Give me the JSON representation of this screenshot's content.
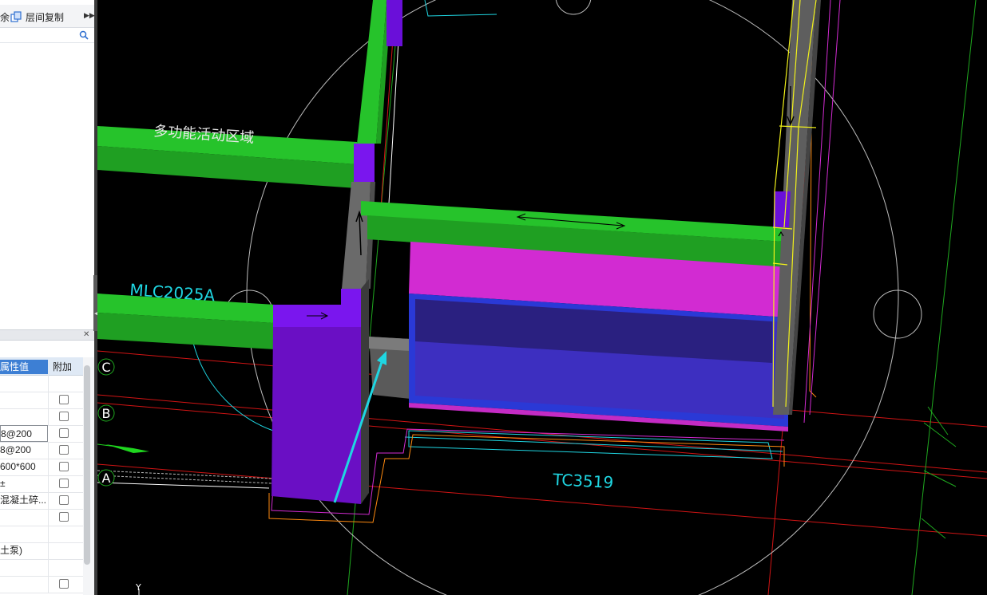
{
  "toolbar": {
    "delete_label_partial": "余",
    "copy_label": "层间复制",
    "more_icon": "double-chevron-right-icon"
  },
  "properties_grid": {
    "header_value": "属性值",
    "header_add": "附加",
    "rows": [
      {
        "value": "",
        "checkbox": false
      },
      {
        "value": "",
        "checkbox": true
      },
      {
        "value": "",
        "checkbox": true
      },
      {
        "value": "8@200",
        "checkbox": true,
        "selected": true
      },
      {
        "value": "8@200",
        "checkbox": true
      },
      {
        "value": "600*600",
        "checkbox": true
      },
      {
        "value": "±",
        "checkbox": true
      },
      {
        "value": "混凝土碎...",
        "checkbox": true
      },
      {
        "value": "",
        "checkbox": true
      },
      {
        "value": "",
        "checkbox": false
      },
      {
        "value": "土泵)",
        "checkbox": false
      },
      {
        "value": "",
        "checkbox": false
      },
      {
        "value": "",
        "checkbox": true
      }
    ]
  },
  "drawing": {
    "room_label": "多功能活动区域",
    "window_label_1": "MLC2025A",
    "window_label_2": "TC3519",
    "axis_labels": [
      "C",
      "B",
      "A"
    ],
    "ucs_axis_label": "Y",
    "colors": {
      "beam_green": "#26c32b",
      "column_purple": "#6a0fd9",
      "magenta": "#d22bd2",
      "blue_box": "#2a39d6",
      "cyan": "#1fd6e2",
      "grid_red": "#d11414",
      "selection_yellow": "#f2f21a"
    }
  }
}
